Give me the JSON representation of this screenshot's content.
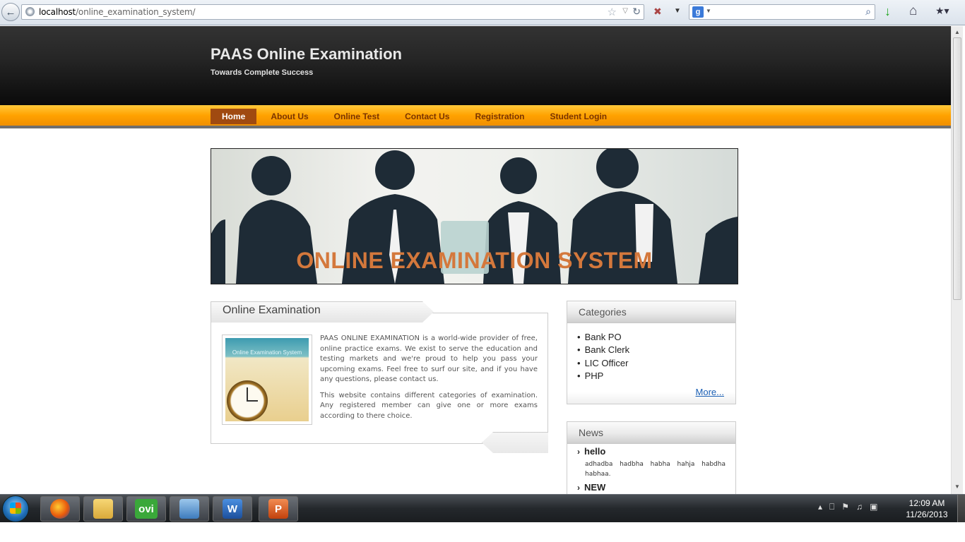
{
  "browser": {
    "url_host": "localhost",
    "url_path": "/online_examination_system/",
    "search_engine_label": "g"
  },
  "site": {
    "title": "PAAS Online Examination",
    "tagline": "Towards Complete Success"
  },
  "nav": {
    "items": [
      {
        "label": "Home",
        "active": true
      },
      {
        "label": "About Us"
      },
      {
        "label": "Online Test"
      },
      {
        "label": "Contact Us"
      },
      {
        "label": "Registration"
      },
      {
        "label": "Student Login"
      }
    ]
  },
  "banner": {
    "title": "ONLINE EXAMINATION SYSTEM"
  },
  "main": {
    "title": "Online Examination",
    "thumb_caption": "Online Examination System",
    "paragraph1": "PAAS ONLINE EXAMINATION is a world-wide provider of free, online practice exams. We exist to serve the education and testing markets and we're proud to help you pass your upcoming exams. Feel free to surf our site, and if you have any questions, please contact us.",
    "paragraph2": "This website contains different categories of examination. Any registered member can give one or more exams according to there choice."
  },
  "categories": {
    "title": "Categories",
    "items": [
      "Bank PO",
      "Bank Clerk",
      "LIC Officer",
      "PHP"
    ],
    "more_label": "More..."
  },
  "news": {
    "title": "News",
    "items": [
      {
        "title": "hello",
        "body": "adhadba hadbha habha hahja habdha habhaa."
      },
      {
        "title": "NEW",
        "body": ""
      }
    ]
  },
  "taskbar": {
    "apps": [
      {
        "name": "firefox",
        "label": ""
      },
      {
        "name": "explorer",
        "label": ""
      },
      {
        "name": "ovi",
        "label": "ovi"
      },
      {
        "name": "control-panel",
        "label": ""
      },
      {
        "name": "word",
        "label": "W"
      },
      {
        "name": "powerpoint",
        "label": "P"
      }
    ],
    "time": "12:09 AM",
    "date": "11/26/2013"
  },
  "colors": {
    "nav_orange": "#ffa200",
    "nav_active": "#a04a10",
    "banner_text": "#d4783c",
    "link_blue": "#1a5fb4"
  }
}
